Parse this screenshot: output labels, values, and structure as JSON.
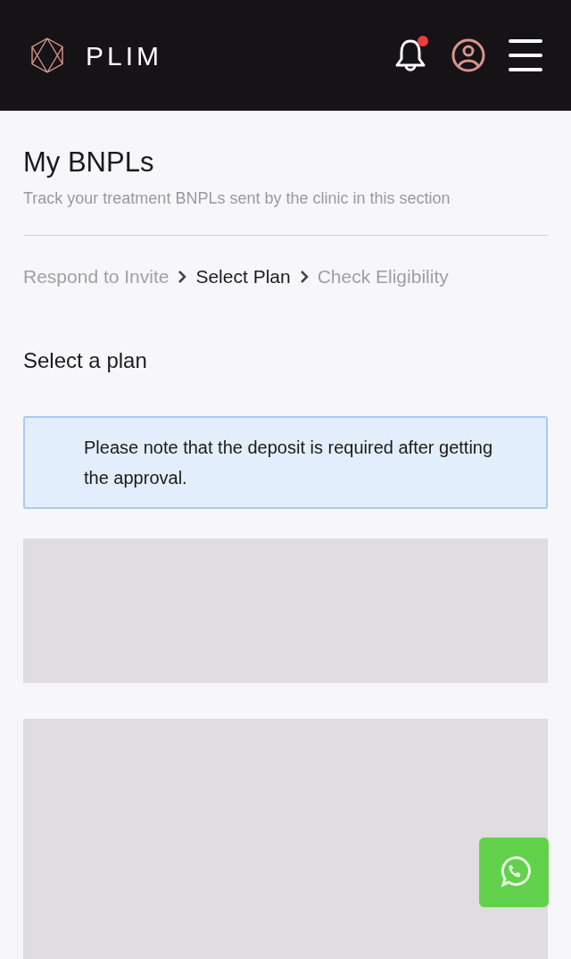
{
  "header": {
    "brand": "PLIM",
    "notifications": {
      "unread": true
    }
  },
  "page": {
    "title": "My BNPLs",
    "subtitle": "Track your treatment BNPLs sent by the clinic in this section"
  },
  "steps": [
    {
      "label": "Respond to Invite",
      "selected": false
    },
    {
      "label": "Select Plan",
      "selected": true
    },
    {
      "label": "Check Eligibility",
      "selected": false
    }
  ],
  "section_title": "Select a plan",
  "notice": "Please note that the deposit is required after getting the approval.",
  "plans": [
    {
      "kind": "placeholder"
    },
    {
      "kind": "placeholder"
    }
  ]
}
